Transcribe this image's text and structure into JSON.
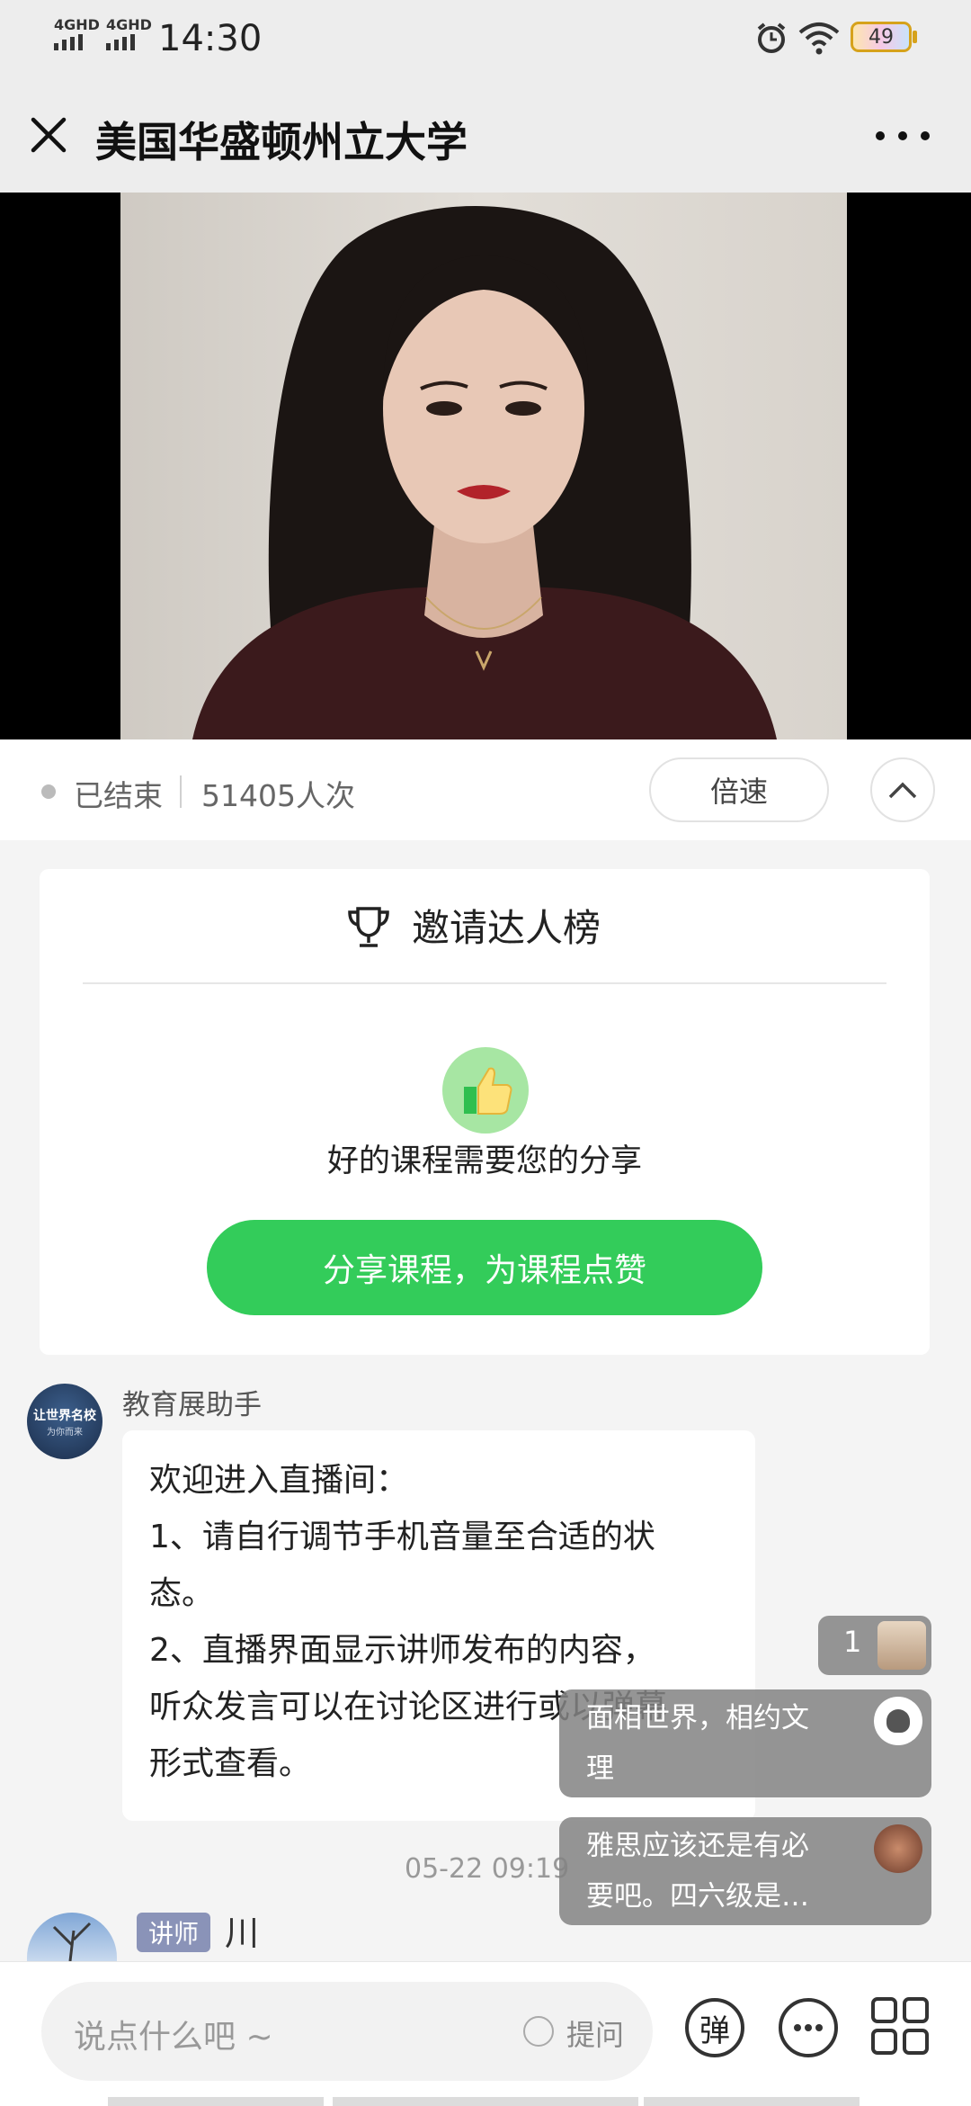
{
  "status_bar": {
    "network_1": "4GHD",
    "network_2": "4GHD",
    "time": "14:30",
    "battery": "49"
  },
  "header": {
    "title": "美国华盛顿州立大学"
  },
  "live_info": {
    "status": "已结束",
    "views": "51405人次",
    "speed_button": "倍速"
  },
  "invite_card": {
    "title": "邀请达人榜",
    "message": "好的课程需要您的分享",
    "share_button": "分享课程，为课程点赞"
  },
  "chat": {
    "assistant_name": "教育展助手",
    "avatar_text": "让世界名校",
    "avatar_subtext": "为你而来",
    "welcome_lines": [
      "欢迎进入直播间：",
      "1、请自行调节手机音量至合适的状",
      "态。",
      "2、直播界面显示讲师发布的内容，",
      "听众发言可以在讨论区进行或以弹幕",
      "形式查看。"
    ],
    "timestamp": "05-22 09:19",
    "lecturer_badge": "讲师",
    "lecturer_name": "川"
  },
  "floating": {
    "viewer_count": "1",
    "danmaku": [
      {
        "lines": [
          "面相世界，相约文",
          "理"
        ]
      },
      {
        "lines": [
          "雅思应该还是有必",
          "要吧。四六级是…"
        ]
      }
    ]
  },
  "bottom_bar": {
    "input_placeholder": "说点什么吧 ~",
    "ask_label": "提问",
    "danmaku_button": "弹"
  },
  "colors": {
    "accent_green": "#33cc5a",
    "lecturer_badge": "#8a93b8"
  }
}
